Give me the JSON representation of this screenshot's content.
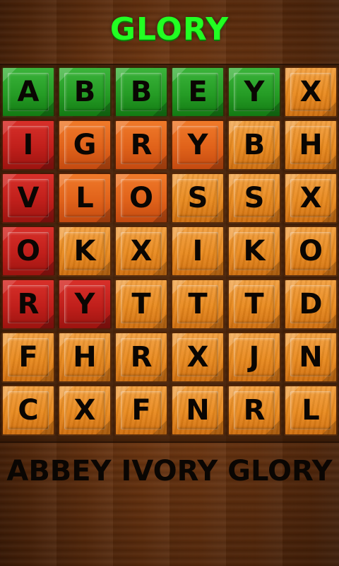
{
  "header": {
    "title": "GLORY",
    "title_color": "#22ff22"
  },
  "board": {
    "rows": [
      [
        {
          "letter": "A",
          "state": "green"
        },
        {
          "letter": "B",
          "state": "green"
        },
        {
          "letter": "B",
          "state": "green"
        },
        {
          "letter": "E",
          "state": "green"
        },
        {
          "letter": "Y",
          "state": "green"
        },
        {
          "letter": "X",
          "state": "orange"
        }
      ],
      [
        {
          "letter": "I",
          "state": "red"
        },
        {
          "letter": "G",
          "state": "orangered"
        },
        {
          "letter": "R",
          "state": "orangered"
        },
        {
          "letter": "Y",
          "state": "orangered"
        },
        {
          "letter": "B",
          "state": "orange"
        },
        {
          "letter": "H",
          "state": "orange"
        }
      ],
      [
        {
          "letter": "V",
          "state": "red"
        },
        {
          "letter": "L",
          "state": "orangered"
        },
        {
          "letter": "O",
          "state": "orangered"
        },
        {
          "letter": "S",
          "state": "orange"
        },
        {
          "letter": "S",
          "state": "orange"
        },
        {
          "letter": "X",
          "state": "orange"
        }
      ],
      [
        {
          "letter": "O",
          "state": "red"
        },
        {
          "letter": "K",
          "state": "orange"
        },
        {
          "letter": "X",
          "state": "orange"
        },
        {
          "letter": "I",
          "state": "orange"
        },
        {
          "letter": "K",
          "state": "orange"
        },
        {
          "letter": "O",
          "state": "orange"
        }
      ],
      [
        {
          "letter": "R",
          "state": "red"
        },
        {
          "letter": "Y",
          "state": "red"
        },
        {
          "letter": "T",
          "state": "orange"
        },
        {
          "letter": "T",
          "state": "orange"
        },
        {
          "letter": "T",
          "state": "orange"
        },
        {
          "letter": "D",
          "state": "orange"
        }
      ],
      [
        {
          "letter": "F",
          "state": "orange"
        },
        {
          "letter": "H",
          "state": "orange"
        },
        {
          "letter": "R",
          "state": "orange"
        },
        {
          "letter": "X",
          "state": "orange"
        },
        {
          "letter": "J",
          "state": "orange"
        },
        {
          "letter": "N",
          "state": "orange"
        }
      ],
      [
        {
          "letter": "C",
          "state": "orange"
        },
        {
          "letter": "X",
          "state": "orange"
        },
        {
          "letter": "F",
          "state": "orange"
        },
        {
          "letter": "N",
          "state": "orange"
        },
        {
          "letter": "R",
          "state": "orange"
        },
        {
          "letter": "L",
          "state": "orange"
        }
      ]
    ]
  },
  "found_words": "ABBEY IVORY GLORY",
  "colors": {
    "green": "#259c25",
    "red": "#c01f1b",
    "orange": "#e8891e",
    "orangered": "#e0621a"
  }
}
